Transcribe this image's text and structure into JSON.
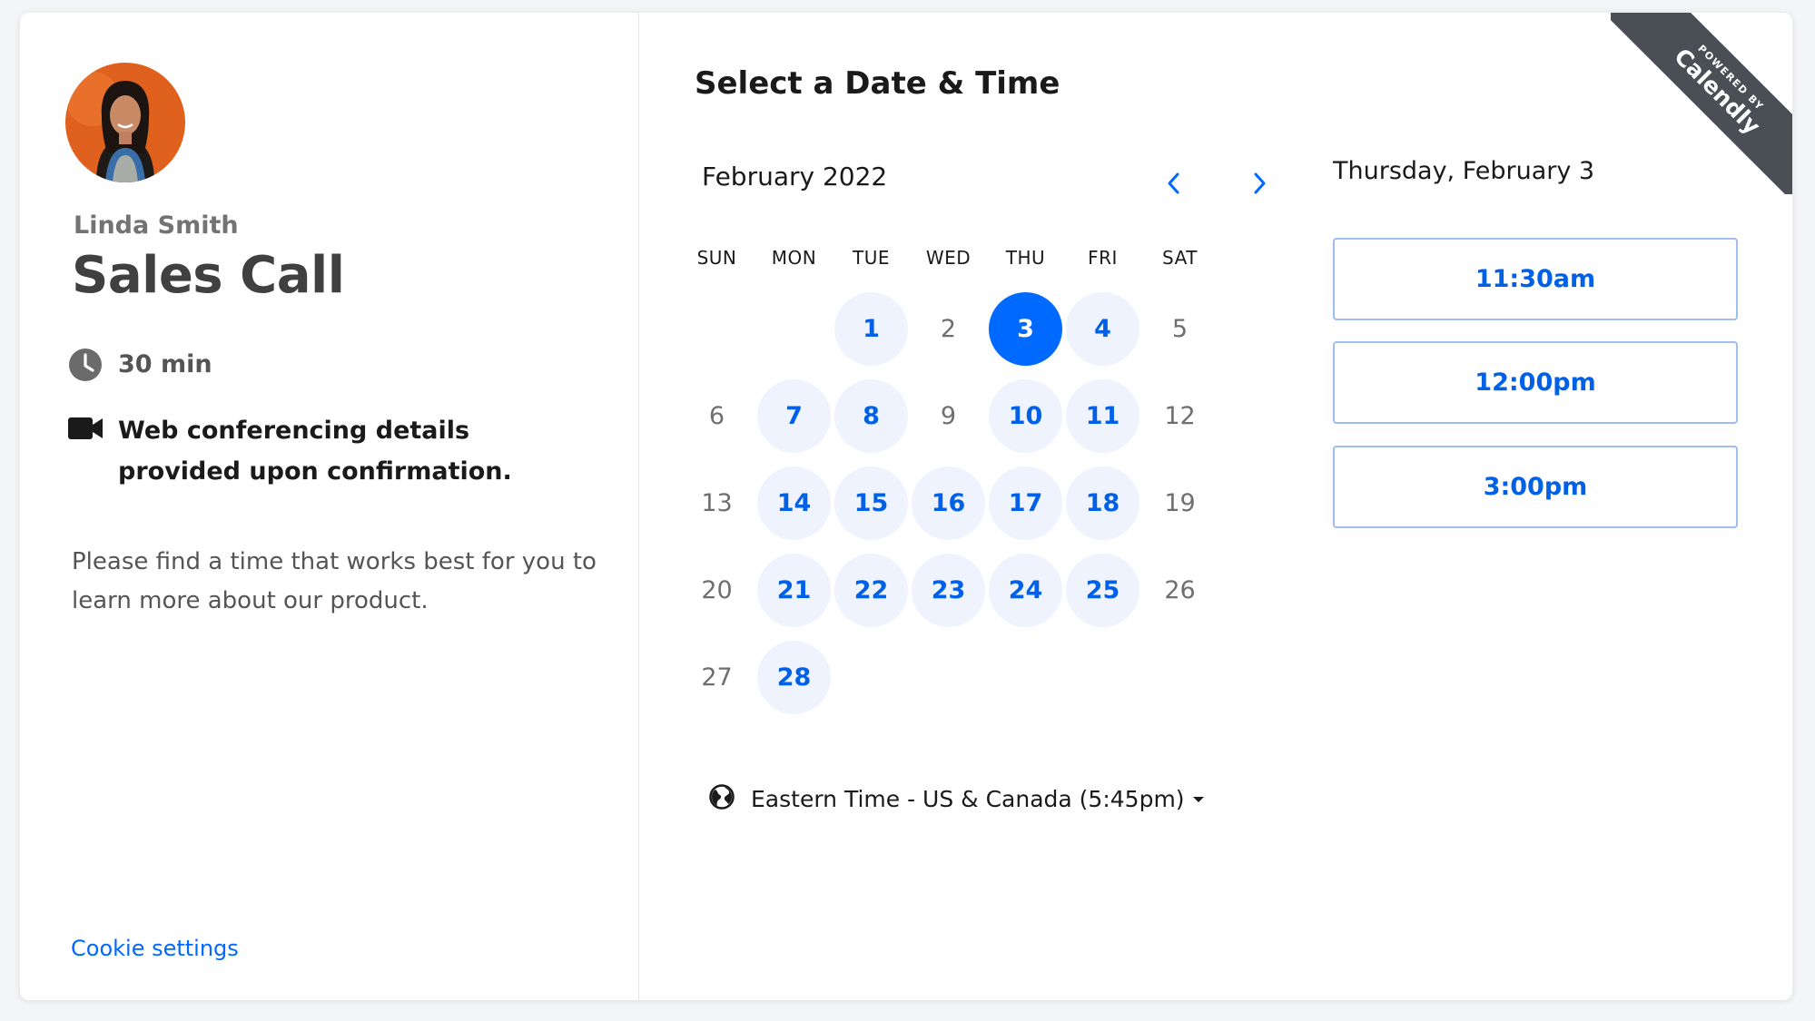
{
  "host": {
    "name": "Linda Smith"
  },
  "event": {
    "title": "Sales Call",
    "duration": "30 min",
    "conferencing": "Web conferencing details provided upon confirmation.",
    "description": "Please find a time that works best for you to learn more about our product."
  },
  "footer": {
    "cookie_settings": "Cookie settings"
  },
  "scheduler": {
    "heading": "Select a Date & Time",
    "month": "February 2022",
    "weekdays": [
      "SUN",
      "MON",
      "TUE",
      "WED",
      "THU",
      "FRI",
      "SAT"
    ],
    "selected_date": "Thursday, February 3",
    "days": [
      {
        "label": "",
        "state": "empty"
      },
      {
        "label": "",
        "state": "empty"
      },
      {
        "label": "1",
        "state": "available"
      },
      {
        "label": "2",
        "state": "unavailable"
      },
      {
        "label": "3",
        "state": "selected"
      },
      {
        "label": "4",
        "state": "available"
      },
      {
        "label": "5",
        "state": "unavailable"
      },
      {
        "label": "6",
        "state": "unavailable"
      },
      {
        "label": "7",
        "state": "available"
      },
      {
        "label": "8",
        "state": "available"
      },
      {
        "label": "9",
        "state": "unavailable"
      },
      {
        "label": "10",
        "state": "available"
      },
      {
        "label": "11",
        "state": "available"
      },
      {
        "label": "12",
        "state": "unavailable"
      },
      {
        "label": "13",
        "state": "unavailable"
      },
      {
        "label": "14",
        "state": "available"
      },
      {
        "label": "15",
        "state": "available"
      },
      {
        "label": "16",
        "state": "available"
      },
      {
        "label": "17",
        "state": "available"
      },
      {
        "label": "18",
        "state": "available"
      },
      {
        "label": "19",
        "state": "unavailable"
      },
      {
        "label": "20",
        "state": "unavailable"
      },
      {
        "label": "21",
        "state": "available"
      },
      {
        "label": "22",
        "state": "available"
      },
      {
        "label": "23",
        "state": "available"
      },
      {
        "label": "24",
        "state": "available"
      },
      {
        "label": "25",
        "state": "available"
      },
      {
        "label": "26",
        "state": "unavailable"
      },
      {
        "label": "27",
        "state": "unavailable"
      },
      {
        "label": "28",
        "state": "available"
      }
    ],
    "timezone": "Eastern Time - US & Canada (5:45pm)",
    "time_slots": [
      "11:30am",
      "12:00pm",
      "3:00pm"
    ]
  },
  "branding": {
    "powered_by": "POWERED BY",
    "brand": "Calendly"
  },
  "colors": {
    "accent": "#0069ff",
    "available_bg": "#eef3fe",
    "ribbon": "#4a4e55",
    "avatar_bg": "#e0611e"
  },
  "icons": {
    "duration": "clock-icon",
    "conferencing": "video-camera-icon",
    "timezone": "globe-icon",
    "prev": "chevron-left-icon",
    "next": "chevron-right-icon",
    "tz_menu": "caret-down-icon"
  }
}
